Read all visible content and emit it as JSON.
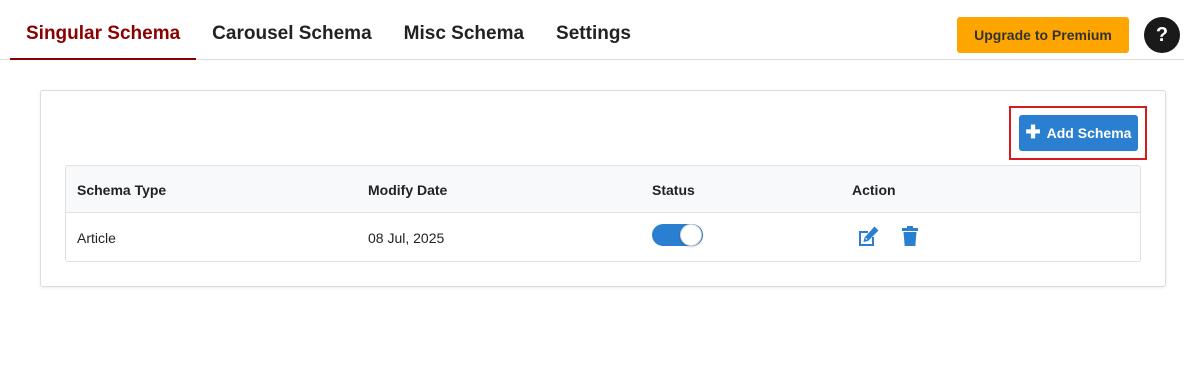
{
  "tabs": [
    {
      "label": "Singular Schema",
      "active": true
    },
    {
      "label": "Carousel Schema",
      "active": false
    },
    {
      "label": "Misc Schema",
      "active": false
    },
    {
      "label": "Settings",
      "active": false
    }
  ],
  "header": {
    "upgrade_label": "Upgrade to Premium",
    "help_label": "?"
  },
  "toolbar": {
    "add_label": "Add Schema",
    "add_icon": "plus-icon"
  },
  "table": {
    "headers": [
      "Schema Type",
      "Modify Date",
      "Status",
      "Action"
    ],
    "rows": [
      {
        "schema_type": "Article",
        "modify_date": "08 Jul, 2025",
        "status": "enabled"
      }
    ]
  },
  "colors": {
    "active_tab": "#8b0000",
    "upgrade": "#ffa500",
    "primary": "#2b7fd0",
    "highlight": "#d71920"
  },
  "icons": {
    "edit": "edit-icon",
    "delete": "trash-icon"
  }
}
